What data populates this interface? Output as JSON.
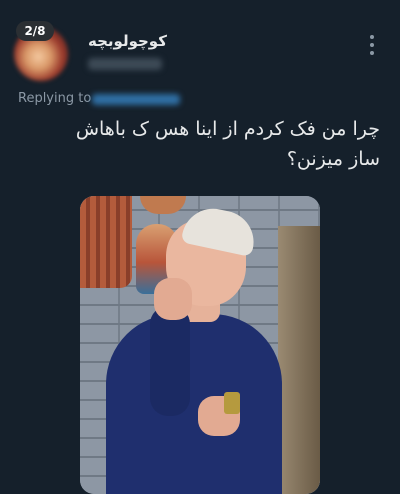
{
  "media_counter": "2/8",
  "author": {
    "display_name": "کوچولوبچه"
  },
  "reply": {
    "label": "Replying to"
  },
  "tweet": {
    "text": "چرا من فک کردم از اینا هس ک باهاش ساز میزنن؟"
  },
  "icons": [
    "more-vertical-icon"
  ],
  "colors": {
    "background": "#15202b",
    "text": "#e7e9ea",
    "secondary_text": "#8b98a5"
  }
}
